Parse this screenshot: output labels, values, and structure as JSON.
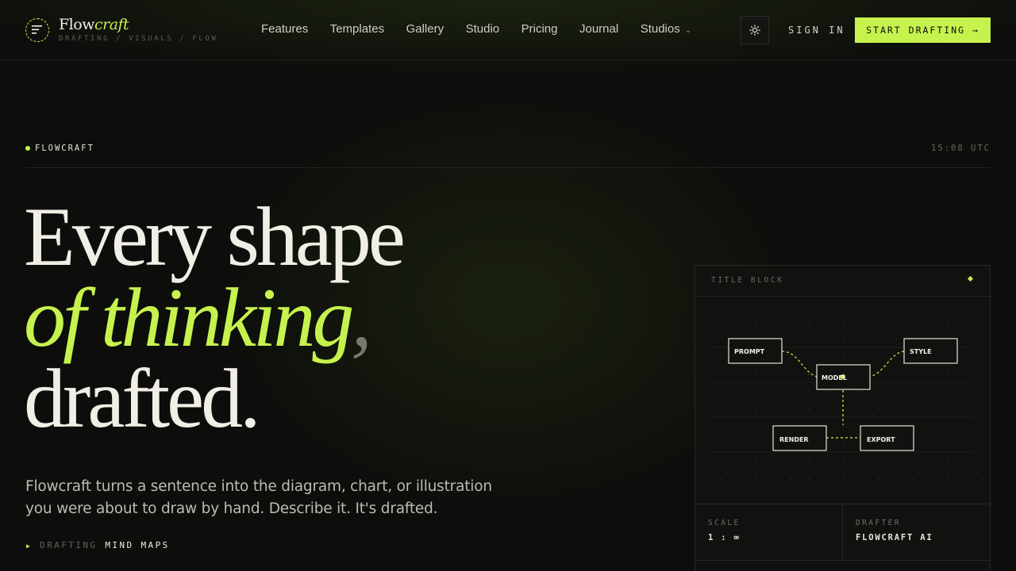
{
  "brand": {
    "name_plain": "Flow",
    "name_accent": "craft",
    "tagline": "DRAFTING / VISUALS / FLOW"
  },
  "nav": {
    "items": [
      "Features",
      "Templates",
      "Gallery",
      "Studio",
      "Pricing",
      "Journal",
      "Studios"
    ]
  },
  "header": {
    "theme_icon": "sun-icon",
    "signin_label": "SIGN IN",
    "cta_label": "START DRAFTING →"
  },
  "meta": {
    "label": "FLOWCRAFT",
    "time": "15:08 UTC"
  },
  "hero": {
    "line1": "Every shape",
    "line2_accent": "of thinking",
    "line2_comma": ",",
    "line3": "drafted.",
    "lede": "Flowcraft turns a sentence into the diagram, chart, or illustration you were about to draw by hand. Describe it. It's drafted.",
    "ticker_prefix": "DRAFTING",
    "ticker_value": "MIND MAPS"
  },
  "card": {
    "title": "TITLE BLOCK",
    "nodes": {
      "prompt": "PROMPT",
      "style": "STYLE",
      "model": "MODEL",
      "render": "RENDER",
      "export": "EXPORT"
    },
    "scale_label": "SCALE",
    "scale_value": "1 : ∞",
    "drafter_label": "DRAFTER",
    "drafter_value": "FLOWCRAFT AI"
  },
  "colors": {
    "accent": "#c6f24e",
    "background": "#0d0e0c",
    "text": "#f1eee5"
  }
}
